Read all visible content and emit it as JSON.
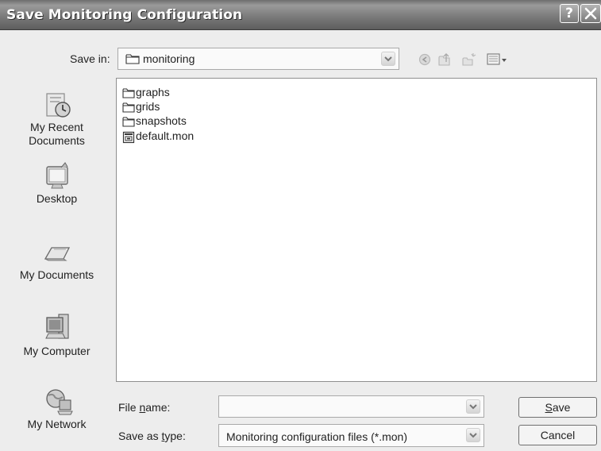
{
  "dialog": {
    "title": "Save Monitoring Configuration",
    "help_glyph": "?",
    "close_glyph": "✕"
  },
  "save_in": {
    "label": "Save in:",
    "value": "monitoring"
  },
  "toolbar_icons": [
    "back-icon",
    "up-folder-icon",
    "new-folder-icon",
    "view-menu-icon"
  ],
  "places": [
    {
      "label_line1": "My Recent",
      "label_line2": "Documents",
      "icon": "recent-documents-icon"
    },
    {
      "label_line1": "Desktop",
      "label_line2": "",
      "icon": "desktop-icon"
    },
    {
      "label_line1": "My Documents",
      "label_line2": "",
      "icon": "my-documents-icon"
    },
    {
      "label_line1": "My Computer",
      "label_line2": "",
      "icon": "my-computer-icon"
    },
    {
      "label_line1": "My Network",
      "label_line2": "",
      "icon": "my-network-icon"
    }
  ],
  "files": [
    {
      "name": "graphs",
      "type": "folder"
    },
    {
      "name": "grids",
      "type": "folder"
    },
    {
      "name": "snapshots",
      "type": "folder"
    },
    {
      "name": "default.mon",
      "type": "file"
    }
  ],
  "file_name": {
    "label_pre": "File ",
    "label_access": "n",
    "label_post": "ame:",
    "value": ""
  },
  "save_as_type": {
    "label_pre": "Save as ",
    "label_access": "t",
    "label_post": "ype:",
    "value": "Monitoring configuration files (*.mon)"
  },
  "buttons": {
    "save_access": "S",
    "save_rest": "ave",
    "cancel": "Cancel"
  }
}
